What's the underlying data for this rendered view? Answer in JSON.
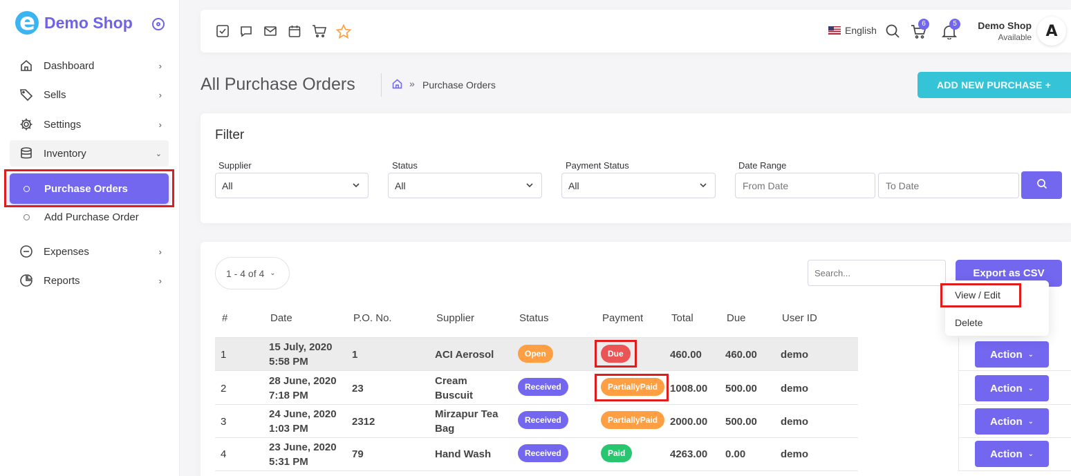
{
  "brand": {
    "name": "Demo Shop"
  },
  "sidebar": {
    "items": [
      {
        "label": "Dashboard",
        "icon": "home-icon"
      },
      {
        "label": "Sells",
        "icon": "tag-icon"
      },
      {
        "label": "Settings",
        "icon": "gear-icon"
      },
      {
        "label": "Inventory",
        "icon": "database-icon"
      },
      {
        "label": "Expenses",
        "icon": "minus-circle-icon"
      },
      {
        "label": "Reports",
        "icon": "pie-chart-icon"
      }
    ],
    "sub_items": [
      {
        "label": "Purchase Orders",
        "active": true
      },
      {
        "label": "Add Purchase Order",
        "active": false
      }
    ]
  },
  "topbar": {
    "language": "English",
    "cart_count": "6",
    "notification_count": "5",
    "user_name": "Demo Shop",
    "user_status": "Available",
    "avatar_letter": "A"
  },
  "page": {
    "title": "All Purchase Orders",
    "breadcrumb": "Purchase Orders",
    "add_button": "ADD NEW PURCHASE +"
  },
  "filter": {
    "title": "Filter",
    "supplier_label": "Supplier",
    "supplier_value": "All",
    "status_label": "Status",
    "status_value": "All",
    "payment_label": "Payment Status",
    "payment_value": "All",
    "date_label": "Date Range",
    "from_placeholder": "From Date",
    "to_placeholder": "To Date"
  },
  "table": {
    "pager": "1 - 4 of 4",
    "search_placeholder": "Search...",
    "export_label": "Export as CSV",
    "columns": [
      "#",
      "Date",
      "P.O. No.",
      "Supplier",
      "Status",
      "Payment",
      "Total",
      "Due",
      "User ID"
    ],
    "rows": [
      {
        "num": "1",
        "date1": "15 July, 2020",
        "date2": "5:58 PM",
        "po": "1",
        "sup1": "ACI Aerosol",
        "sup2": "",
        "status": "Open",
        "payment": "Due",
        "total": "460.00",
        "due": "460.00",
        "user": "demo",
        "action": "Action"
      },
      {
        "num": "2",
        "date1": "28 June, 2020",
        "date2": "7:18 PM",
        "po": "23",
        "sup1": "Cream",
        "sup2": "Buscuit",
        "status": "Received",
        "payment": "PartiallyPaid",
        "total": "1008.00",
        "due": "500.00",
        "user": "demo",
        "action": "Action"
      },
      {
        "num": "3",
        "date1": "24 June, 2020",
        "date2": "1:03 PM",
        "po": "2312",
        "sup1": "Mirzapur Tea",
        "sup2": "Bag",
        "status": "Received",
        "payment": "PartiallyPaid",
        "total": "2000.00",
        "due": "500.00",
        "user": "demo",
        "action": "Action"
      },
      {
        "num": "4",
        "date1": "23 June, 2020",
        "date2": "5:31 PM",
        "po": "79",
        "sup1": "Hand Wash",
        "sup2": "",
        "status": "Received",
        "payment": "Paid",
        "total": "4263.00",
        "due": "0.00",
        "user": "demo",
        "action": "Action"
      }
    ],
    "dropdown": [
      "View / Edit",
      "Delete"
    ]
  },
  "colors": {
    "primary": "#7367f0",
    "cyan": "#35c3d8",
    "open": "#ff9f43",
    "due": "#ea5455",
    "partial": "#ff9f43",
    "paid": "#28c76f",
    "highlight": "#e01c1c"
  }
}
